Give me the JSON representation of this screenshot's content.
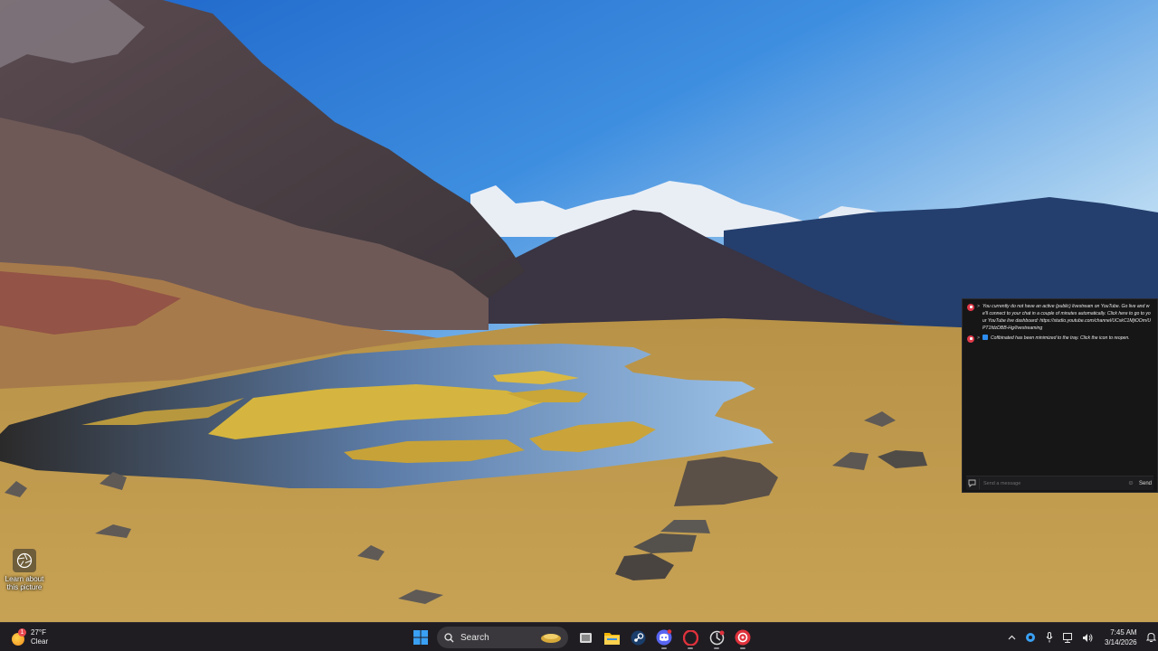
{
  "wallpaper": {
    "sky_color_top": "#1f6fd1",
    "sky_color_bottom": "#a9d0ef",
    "description_hidden": true
  },
  "learn_picture": {
    "label": "Learn about this picture"
  },
  "chat": {
    "messages": [
      {
        "prefix": ">",
        "text": "You currently do not have an active (public) livestream on YouTube. Go live and we'll connect to your chat in a couple of minutes automatically. Click here to go to your YouTube live dashboard: https://studio.youtube.com/channel/UCxkC1MjiOOm/UPT1fdzDBB-Hg/livestreaming"
      },
      {
        "prefix": ">",
        "text": "Cofibinated has been minimized to the tray. Click the icon to reopen."
      }
    ],
    "input_placeholder": "Send a message",
    "send_label": "Send"
  },
  "taskbar": {
    "weather": {
      "badge": "1",
      "temperature": "27°F",
      "condition": "Clear"
    },
    "search_label": "Search",
    "clock": {
      "time": "7:45 AM",
      "date": "3/14/2026"
    },
    "icons": [
      "windows-start-icon",
      "task-view-icon",
      "file-explorer-icon",
      "steam-icon",
      "discord-icon",
      "opera-icon",
      "app-icon",
      "obs-app-icon"
    ],
    "colors": {
      "taskbar_bg": "#1f1d22",
      "accent_red": "#e0323c",
      "windows_blue": "#3aa0f3"
    }
  }
}
